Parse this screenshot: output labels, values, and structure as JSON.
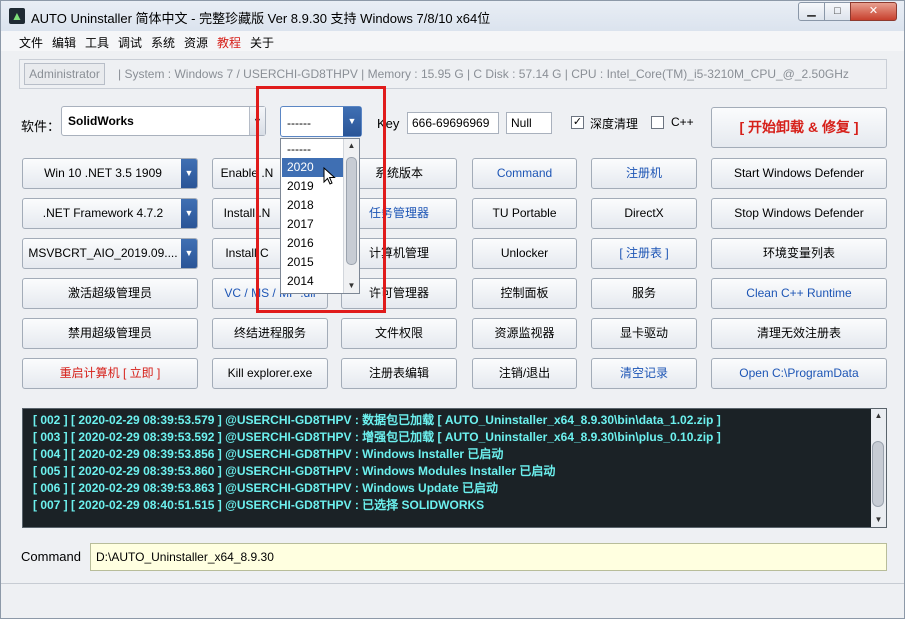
{
  "window": {
    "title": "AUTO Uninstaller 简体中文 - 完整珍藏版 Ver 8.9.30 支持 Windows 7/8/10 x64位",
    "min_icon": "minimize-icon",
    "max_icon": "maximize-icon",
    "close_icon": "close-icon"
  },
  "menu": [
    "文件",
    "编辑",
    "工具",
    "调试",
    "系统",
    "资源",
    "教程",
    "关于"
  ],
  "menu_highlight_color": "#d6201a",
  "sysinfo": {
    "admin": "Administrator",
    "details": "| System : Windows 7  /  USERCHI-GD8THPV   |  Memory : 15.95 G  |  C Disk : 57.14 G  |  CPU : Intel_Core(TM)_i5-3210M_CPU_@_2.50GHz"
  },
  "controls": {
    "software_label": "软件：",
    "software_value": "SolidWorks",
    "year_value": "------",
    "key_label": "Key",
    "key_value": "666-69696969",
    "null_value": "Null",
    "deep_clean_label": "深度清理",
    "deep_clean_checked": "✓",
    "cpp_label": "C++",
    "start_button": "[ 开始卸载 & 修复 ]"
  },
  "dropdown": {
    "items": [
      "------",
      "2020",
      "2019",
      "2018",
      "2017",
      "2016",
      "2015",
      "2014"
    ],
    "highlighted": "2020"
  },
  "buttons": {
    "r1": [
      "Win 10 .NET 3.5 1909",
      "Enable .N",
      "系统版本",
      "Command",
      "注册机",
      "Start  Windows Defender"
    ],
    "r2": [
      ".NET Framework 4.7.2",
      "Install .N",
      "任务管理器",
      "TU Portable",
      "DirectX",
      "Stop  Windows Defender"
    ],
    "r3": [
      "MSVBCRT_AIO_2019.09....",
      "Install C",
      "计算机管理",
      "Unlocker",
      "[ 注册表 ]",
      "环境变量列表"
    ],
    "r4": [
      "激活超级管理员",
      "VC / MS / MP .dll",
      "许可管理器",
      "控制面板",
      "服务",
      "Clean C++ Runtime"
    ],
    "r5": [
      "禁用超级管理员",
      "终结进程服务",
      "文件权限",
      "资源监视器",
      "显卡驱动",
      "清理无效注册表"
    ],
    "r6": [
      "重启计算机 [ 立即 ]",
      "Kill explorer.exe",
      "注册表编辑",
      "注销/退出",
      "清空记录",
      "Open C:\\ProgramData"
    ]
  },
  "log": [
    "[ 002 ]  [ 2020-02-29 08:39:53.579 ]  @USERCHI-GD8THPV : 数据包已加载 [ AUTO_Uninstaller_x64_8.9.30\\bin\\data_1.02.zip ]",
    "[ 003 ]  [ 2020-02-29 08:39:53.592 ]  @USERCHI-GD8THPV : 增强包已加载 [ AUTO_Uninstaller_x64_8.9.30\\bin\\plus_0.10.zip ]",
    "[ 004 ]  [ 2020-02-29 08:39:53.856 ]  @USERCHI-GD8THPV : Windows Installer 已启动",
    "[ 005 ]  [ 2020-02-29 08:39:53.860 ]  @USERCHI-GD8THPV : Windows Modules Installer 已启动",
    "[ 006 ]  [ 2020-02-29 08:39:53.863 ]  @USERCHI-GD8THPV : Windows Update 已启动",
    "[ 007 ]  [ 2020-02-29 08:40:51.515 ]  @USERCHI-GD8THPV : 已选择 SOLIDWORKS"
  ],
  "command": {
    "label": "Command",
    "value": "D:\\AUTO_Uninstaller_x64_8.9.30"
  }
}
